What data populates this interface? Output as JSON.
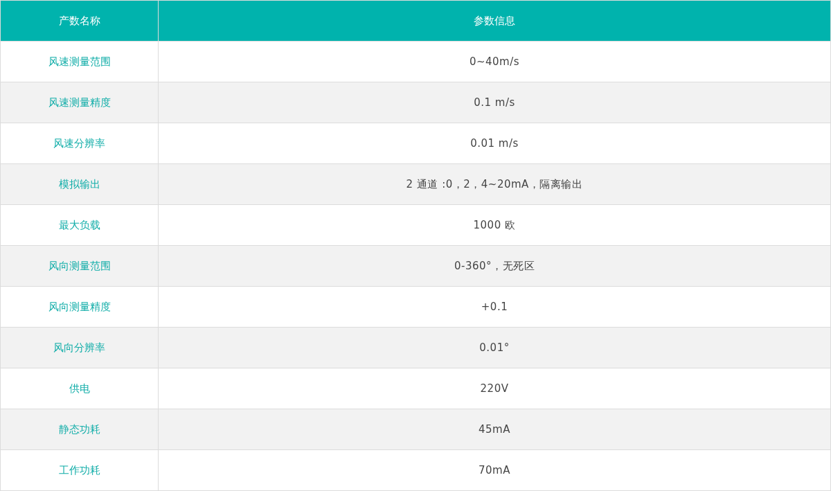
{
  "table": {
    "columns": [
      "产数名称",
      "参数信息"
    ],
    "rows": [
      [
        "风速测量范围",
        "0~40m/s"
      ],
      [
        "风速测量精度",
        "0.1 m/s"
      ],
      [
        "风速分辨率",
        "0.01 m/s"
      ],
      [
        "模拟输出",
        "2 通道 :0，2，4~20mA，隔离输出"
      ],
      [
        "最大负载",
        "1000 欧"
      ],
      [
        "风向测量范围",
        "0-360°，无死区"
      ],
      [
        "风向测量精度",
        "+0.1"
      ],
      [
        "风向分辨率",
        "0.01°"
      ],
      [
        "供电",
        "220V"
      ],
      [
        "静态功耗",
        "45mA"
      ],
      [
        "工作功耗",
        "70mA"
      ]
    ]
  }
}
